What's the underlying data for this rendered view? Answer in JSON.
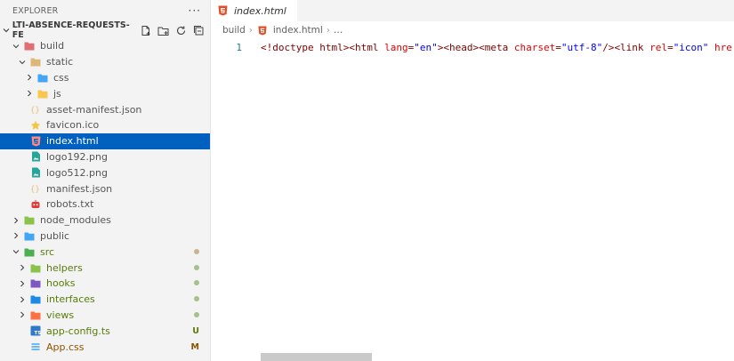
{
  "sidebar": {
    "title": "EXPLORER",
    "more": "···",
    "project": "LTI-ABSENCE-REQUESTS-FE",
    "actions": [
      "new-file-icon",
      "new-folder-icon",
      "refresh-icon",
      "collapse-all-icon"
    ],
    "tree": [
      {
        "label": "build",
        "indent": 1,
        "chev": "down",
        "icon": "folder-build-icon",
        "color": "#e06c75"
      },
      {
        "label": "static",
        "indent": 2,
        "chev": "down",
        "icon": "folder-icon",
        "color": "#dcb67a"
      },
      {
        "label": "css",
        "indent": 3,
        "chev": "right",
        "icon": "folder-css-icon",
        "color": "#42a5f5"
      },
      {
        "label": "js",
        "indent": 3,
        "chev": "right",
        "icon": "folder-js-icon",
        "color": "#f9c74f"
      },
      {
        "label": "asset-manifest.json",
        "indent": 2,
        "chev": "",
        "icon": "json-icon",
        "color": "#e5c07b"
      },
      {
        "label": "favicon.ico",
        "indent": 2,
        "chev": "",
        "icon": "star-icon",
        "color": "#f4c542"
      },
      {
        "label": "index.html",
        "indent": 2,
        "chev": "",
        "icon": "html5-icon",
        "color": "#e44d26",
        "selected": true
      },
      {
        "label": "logo192.png",
        "indent": 2,
        "chev": "",
        "icon": "image-icon",
        "color": "#26a69a"
      },
      {
        "label": "logo512.png",
        "indent": 2,
        "chev": "",
        "icon": "image-icon",
        "color": "#26a69a"
      },
      {
        "label": "manifest.json",
        "indent": 2,
        "chev": "",
        "icon": "json-icon",
        "color": "#e5c07b"
      },
      {
        "label": "robots.txt",
        "indent": 2,
        "chev": "",
        "icon": "robot-icon",
        "color": "#e53935"
      },
      {
        "label": "node_modules",
        "indent": 1,
        "chev": "right",
        "icon": "folder-node-icon",
        "color": "#8bc34a"
      },
      {
        "label": "public",
        "indent": 1,
        "chev": "right",
        "icon": "folder-public-icon",
        "color": "#42a5f5"
      },
      {
        "label": "src",
        "indent": 1,
        "chev": "down",
        "icon": "folder-src-icon",
        "color": "#4caf50",
        "git": "dot",
        "green": true
      },
      {
        "label": "helpers",
        "indent": 2,
        "chev": "right",
        "icon": "folder-helper-icon",
        "color": "#8bc34a",
        "git": "dot",
        "green": true
      },
      {
        "label": "hooks",
        "indent": 2,
        "chev": "right",
        "icon": "folder-hooks-icon",
        "color": "#7e57c2",
        "git": "dot",
        "green": true
      },
      {
        "label": "interfaces",
        "indent": 2,
        "chev": "right",
        "icon": "folder-interfaces-icon",
        "color": "#1e88e5",
        "git": "dot",
        "green": true
      },
      {
        "label": "views",
        "indent": 2,
        "chev": "right",
        "icon": "folder-views-icon",
        "color": "#ff7043",
        "git": "dot",
        "green": true
      },
      {
        "label": "app-config.ts",
        "indent": 2,
        "chev": "",
        "icon": "typescript-icon",
        "color": "#3178c6",
        "git": "U",
        "green": true
      },
      {
        "label": "App.css",
        "indent": 2,
        "chev": "",
        "icon": "css-icon",
        "color": "#42a5f5",
        "git": "M",
        "orange": true
      }
    ]
  },
  "colors": {
    "dot_added": "#a6c08a",
    "dot_modified": "#c7b592",
    "U": "#587c0c",
    "M": "#895503"
  },
  "editor": {
    "tab": "index.html",
    "breadcrumb": {
      "folder": "build",
      "file": "index.html",
      "more": "…"
    },
    "line_number": "1",
    "code_parts": [
      {
        "t": "<!doctype html>",
        "c": "c-tag"
      },
      {
        "t": "<html",
        "c": "c-tag"
      },
      {
        "t": " lang",
        "c": "c-attr"
      },
      {
        "t": "=",
        "c": "c-pun"
      },
      {
        "t": "\"en\"",
        "c": "c-val"
      },
      {
        "t": ">",
        "c": "c-tag"
      },
      {
        "t": "<head>",
        "c": "c-tag"
      },
      {
        "t": "<meta",
        "c": "c-tag"
      },
      {
        "t": " charset",
        "c": "c-attr"
      },
      {
        "t": "=",
        "c": "c-pun"
      },
      {
        "t": "\"utf-8\"",
        "c": "c-val"
      },
      {
        "t": "/>",
        "c": "c-tag"
      },
      {
        "t": "<link",
        "c": "c-tag"
      },
      {
        "t": " rel",
        "c": "c-attr"
      },
      {
        "t": "=",
        "c": "c-pun"
      },
      {
        "t": "\"icon\"",
        "c": "c-val"
      },
      {
        "t": " hre",
        "c": "c-attr"
      }
    ]
  }
}
